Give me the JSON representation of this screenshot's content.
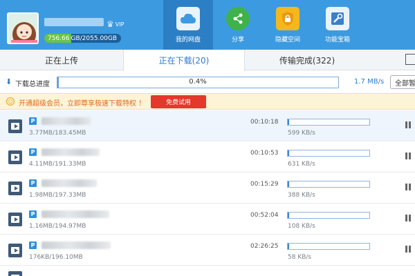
{
  "header": {
    "vip_label": "VIP",
    "quota_used": "756.66",
    "quota_rest": "GB/2055.00GB",
    "nav": [
      {
        "label": "我的网盘",
        "icon": "cloud-icon",
        "active": true
      },
      {
        "label": "分享",
        "icon": "share-icon",
        "active": false
      },
      {
        "label": "隐藏空间",
        "icon": "lock-icon",
        "active": false
      },
      {
        "label": "功能宝箱",
        "icon": "toolbox-icon",
        "active": false
      }
    ]
  },
  "tabs": [
    {
      "label": "正在上传"
    },
    {
      "label": "正在下载(20)"
    },
    {
      "label": "传输完成(322)"
    }
  ],
  "overall": {
    "label": "下载总进度",
    "percent_text": "0.4%",
    "percent": 0.4,
    "speed": "1.7 MB/s",
    "all_pause_label": "全部暂"
  },
  "promo": {
    "text": "开通超级会员，立即尊享极速下载特权 ！",
    "button": "免费试用"
  },
  "downloads": [
    {
      "size": "3.77MB/183.45MB",
      "eta": "00:10:18",
      "speed": "599 KB/s",
      "progress": 0.02,
      "name_len": 72
    },
    {
      "size": "4.11MB/191.33MB",
      "eta": "00:10:53",
      "speed": "631 KB/s",
      "progress": 0.02,
      "name_len": 84
    },
    {
      "size": "1.98MB/197.33MB",
      "eta": "00:15:29",
      "speed": "388 KB/s",
      "progress": 0.01,
      "name_len": 80
    },
    {
      "size": "1.16MB/194.97MB",
      "eta": "00:52:04",
      "speed": "108 KB/s",
      "progress": 0.01,
      "name_len": 98
    },
    {
      "size": "176KB/196.10MB",
      "eta": "02:26:25",
      "speed": "58 KB/s",
      "progress": 0.001,
      "name_len": 100
    }
  ]
}
